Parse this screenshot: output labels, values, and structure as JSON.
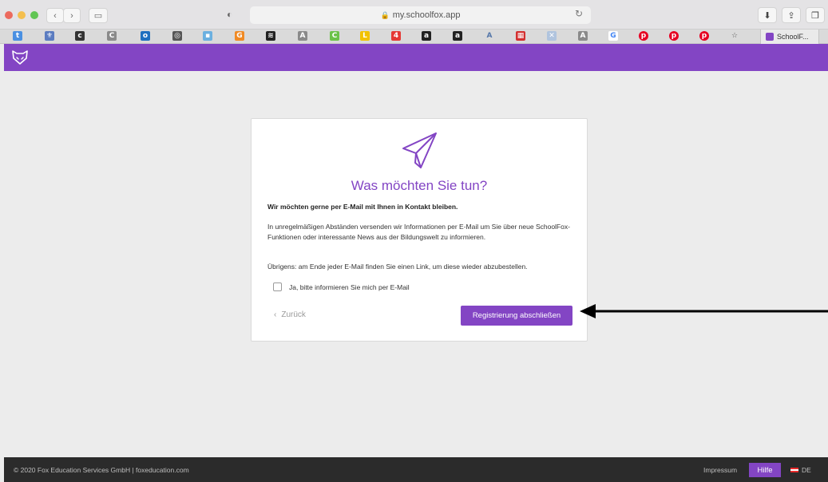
{
  "browser": {
    "url": "my.schoolfox.app",
    "tab_title": "SchoolF..."
  },
  "card": {
    "title": "Was möchten Sie tun?",
    "lead": "Wir möchten gerne per E-Mail mit Ihnen in Kontakt bleiben.",
    "paragraph1": "In unregelmäßigen Abständen versenden wir Informationen per E-Mail um Sie über neue SchoolFox-Funktionen oder interessante News aus der Bildungswelt zu informieren.",
    "paragraph2": "Übrigens: am Ende jeder E-Mail finden Sie einen Link, um diese wieder abzubestellen.",
    "checkbox_label": "Ja, bitte informieren Sie mich per E-Mail",
    "checkbox_checked": false,
    "back_label": "Zurück",
    "submit_label": "Registrierung abschließen"
  },
  "footer": {
    "copyright": "© 2020 Fox Education Services GmbH | foxeducation.com",
    "impressum": "Impressum",
    "help": "Hilfe",
    "language": "DE"
  },
  "colors": {
    "brand": "#8345c4",
    "footer": "#2b2b2b"
  }
}
